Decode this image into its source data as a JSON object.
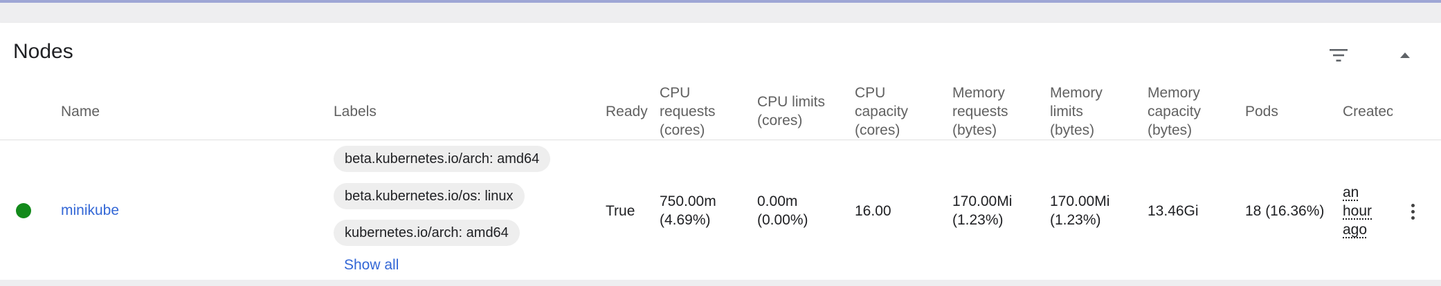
{
  "card": {
    "title": "Nodes"
  },
  "icons": {
    "filter": "filter-list-icon",
    "collapse": "chevron-up-icon",
    "more": "more-vert-icon"
  },
  "columns": {
    "name": "Name",
    "labels": "Labels",
    "ready": "Ready",
    "cpu_requests": [
      "CPU",
      "requests",
      "(cores)"
    ],
    "cpu_limits": [
      "CPU limits",
      "(cores)"
    ],
    "cpu_capacity": [
      "CPU",
      "capacity",
      "(cores)"
    ],
    "memory_requests": [
      "Memory",
      "requests",
      "(bytes)"
    ],
    "memory_limits": [
      "Memory",
      "limits",
      "(bytes)"
    ],
    "memory_capacity": [
      "Memory",
      "capacity",
      "(bytes)"
    ],
    "pods": "Pods",
    "created": "Createc"
  },
  "row": {
    "status_color": "#138a1b",
    "name": "minikube",
    "labels": [
      "beta.kubernetes.io/arch: amd64",
      "beta.kubernetes.io/os: linux",
      "kubernetes.io/arch: amd64"
    ],
    "show_all": "Show all",
    "ready": "True",
    "cpu_requests": [
      "750.00m",
      "(4.69%)"
    ],
    "cpu_limits": [
      "0.00m",
      "(0.00%)"
    ],
    "cpu_capacity": "16.00",
    "memory_requests": [
      "170.00Mi",
      "(1.23%)"
    ],
    "memory_limits": [
      "170.00Mi",
      "(1.23%)"
    ],
    "memory_capacity": "13.46Gi",
    "pods": "18 (16.36%)",
    "created": [
      "an",
      "hour",
      "ago"
    ]
  },
  "colors": {
    "link": "#3367d6",
    "accent_top": "#5c6bc0"
  }
}
